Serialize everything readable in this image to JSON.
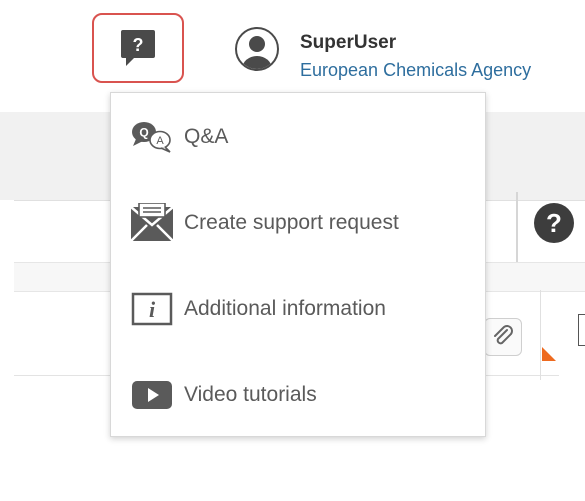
{
  "header": {
    "help_icon": "help-speech-bubble-icon",
    "help_glyph": "?",
    "user_name": "SuperUser",
    "user_org": "European Chemicals Agency",
    "avatar_icon": "user-avatar-icon"
  },
  "help_menu": {
    "items": [
      {
        "label": "Q&A",
        "icon": "qa-speech-bubbles-icon"
      },
      {
        "label": "Create support request",
        "icon": "envelope-icon"
      },
      {
        "label": "Additional information",
        "icon": "info-icon"
      },
      {
        "label": "Video tutorials",
        "icon": "video-play-icon"
      }
    ]
  },
  "background": {
    "help_glyph": "?",
    "paperclip_icon": "paperclip-icon"
  },
  "colors": {
    "accent_border": "#d9534f",
    "org_link": "#2e6e9e",
    "icon_dark": "#3d3d3d",
    "flag_orange": "#ee6a1f"
  }
}
